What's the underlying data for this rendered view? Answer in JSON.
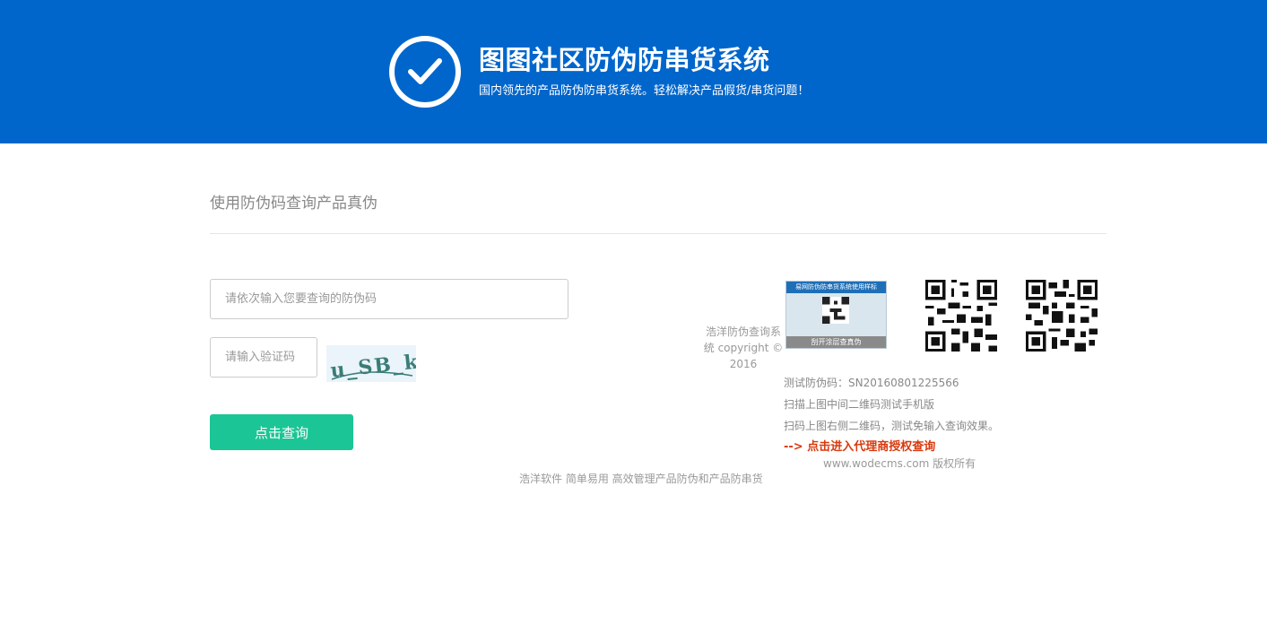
{
  "header": {
    "title": "图图社区防伪防串货系统",
    "subtitle": "国内领先的产品防伪防串货系统。轻松解决产品假货/串货问题！",
    "logo_icon": "check-circle-icon",
    "background": "#0066cc"
  },
  "query": {
    "section_title": "使用防伪码查询产品真伪",
    "code_placeholder": "请依次输入您要查询的防伪码",
    "captcha_placeholder": "请输入验证码",
    "captcha_text": "u_SB_k",
    "submit_label": "点击查询",
    "submit_color": "#1cc595"
  },
  "sidebar": {
    "copyright": "浩洋防伪查询系统 copyright © 2016",
    "sample_label": {
      "header": "易网防伪防串货系统使用样标",
      "footer": "刮开涂层查真伪"
    },
    "test_code": "测试防伪码：SN20160801225566",
    "scan_mobile": "扫描上图中间二维码测试手机版",
    "scan_right": "扫码上图右侧二维码，测试免输入查询效果。",
    "agent_link": "--> 点击进入代理商授权查询",
    "site_copyright": "www.wodecms.com 版权所有"
  },
  "footer": {
    "slogan": "浩洋软件 简单易用 高效管理产品防伪和产品防串货"
  }
}
